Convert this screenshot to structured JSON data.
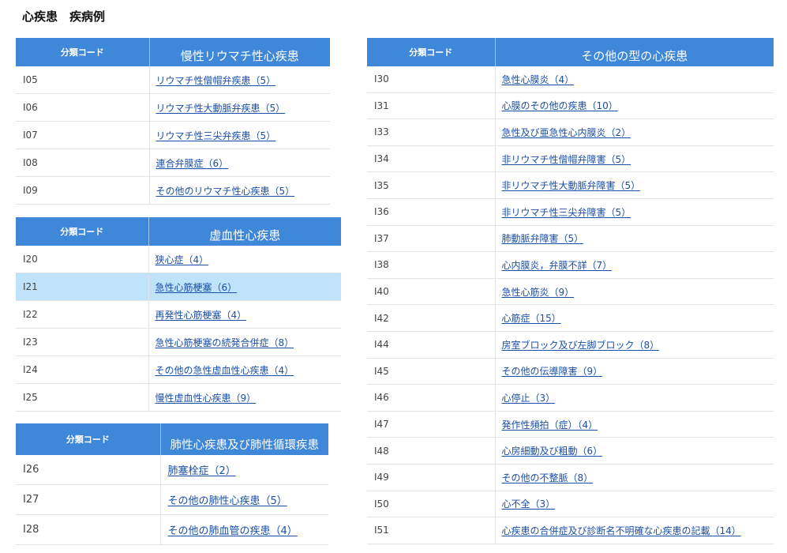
{
  "page_title": "心疾患　疾病例",
  "code_header": "分類コード",
  "tables": [
    {
      "title": "慢性リウマチ性心疾患",
      "rows": [
        {
          "code": "I05",
          "name": "リウマチ性僧帽弁疾患（5）"
        },
        {
          "code": "I06",
          "name": "リウマチ性大動脈弁疾患（5）"
        },
        {
          "code": "I07",
          "name": "リウマチ性三尖弁疾患（5）"
        },
        {
          "code": "I08",
          "name": "連合弁膜症（6）"
        },
        {
          "code": "I09",
          "name": "その他のリウマチ性心疾患（5）"
        }
      ]
    },
    {
      "title": "虚血性心疾患",
      "rows": [
        {
          "code": "I20",
          "name": "狭心症（4）"
        },
        {
          "code": "I21",
          "name": "急性心筋梗塞（6）"
        },
        {
          "code": "I22",
          "name": "再発性心筋梗塞（4）"
        },
        {
          "code": "I23",
          "name": "急性心筋梗塞の続発合併症（8）"
        },
        {
          "code": "I24",
          "name": "その他の急性虚血性心疾患（4）"
        },
        {
          "code": "I25",
          "name": "慢性虚血性心疾患（9）"
        }
      ]
    },
    {
      "title": "肺性心疾患及び肺性循環疾患",
      "rows": [
        {
          "code": "I26",
          "name": "肺塞栓症（2）"
        },
        {
          "code": "I27",
          "name": "その他の肺性心疾患（5）"
        },
        {
          "code": "I28",
          "name": "その他の肺血管の疾患（4）"
        }
      ]
    },
    {
      "title": "その他の型の心疾患",
      "rows": [
        {
          "code": "I30",
          "name": "急性心膜炎（4）"
        },
        {
          "code": "I31",
          "name": "心膜のその他の疾患（10）"
        },
        {
          "code": "I33",
          "name": "急性及び亜急性心内膜炎（2）"
        },
        {
          "code": "I34",
          "name": "非リウマチ性僧帽弁障害（5）"
        },
        {
          "code": "I35",
          "name": "非リウマチ性大動脈弁障害（5）"
        },
        {
          "code": "I36",
          "name": "非リウマチ性三尖弁障害（5）"
        },
        {
          "code": "I37",
          "name": "肺動脈弁障害（5）"
        },
        {
          "code": "I38",
          "name": "心内膜炎，弁膜不詳（7）"
        },
        {
          "code": "I40",
          "name": "急性心筋炎（9）"
        },
        {
          "code": "I42",
          "name": "心筋症（15）"
        },
        {
          "code": "I44",
          "name": "房室ブロック及び左脚ブロック（8）"
        },
        {
          "code": "I45",
          "name": "その他の伝導障害（9）"
        },
        {
          "code": "I46",
          "name": "心停止（3）"
        },
        {
          "code": "I47",
          "name": "発作性頻拍（症）（4）"
        },
        {
          "code": "I48",
          "name": "心房細動及び粗動（6）"
        },
        {
          "code": "I49",
          "name": "その他の不整脈（8）"
        },
        {
          "code": "I50",
          "name": "心不全（3）"
        },
        {
          "code": "I51",
          "name": "心疾患の合併症及び診断名不明確な心疾患の記載（14）"
        }
      ]
    }
  ],
  "colors": {
    "header_bg": "#3f87d8",
    "highlight_row": "#bfe3fb",
    "link": "#1a4fa8"
  }
}
